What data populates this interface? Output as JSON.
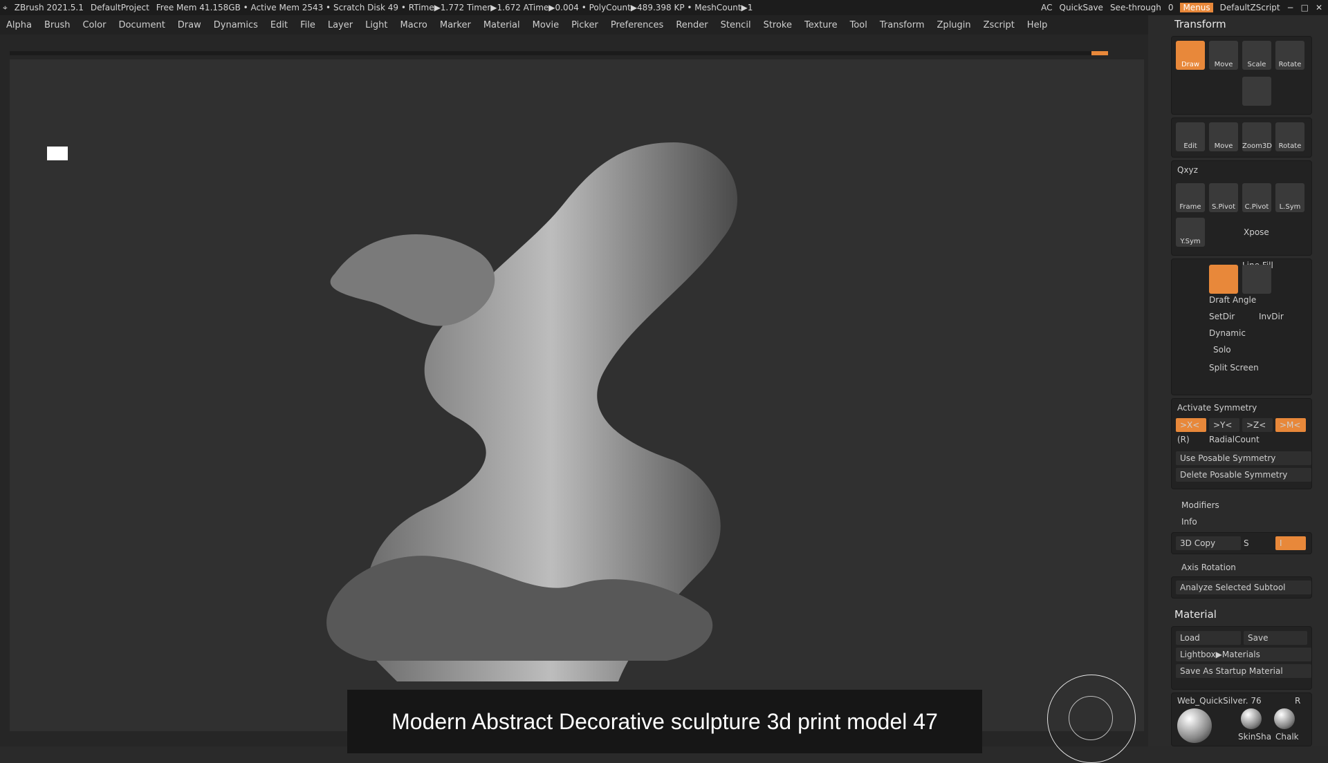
{
  "app": {
    "title": "ZBrush 2021.5.1",
    "project": "DefaultProject",
    "status_line": "Free Mem 41.158GB • Active Mem 2543 • Scratch Disk 49 • RTime▶1.772 Timer▶1.672 ATime▶0.004 • PolyCount▶489.398 KP • MeshCount▶1",
    "right_controls": {
      "ac": "AC",
      "quicksave": "QuickSave",
      "see_through_label": "See-through",
      "see_through_value": "0",
      "menus": "Menus",
      "default_zscript": "DefaultZScript"
    }
  },
  "menubar": {
    "items": [
      "Alpha",
      "Brush",
      "Color",
      "Document",
      "Draw",
      "Dynamics",
      "Edit",
      "File",
      "Layer",
      "Light",
      "Macro",
      "Marker",
      "Material",
      "Movie",
      "Picker",
      "Preferences",
      "Render",
      "Stencil",
      "Stroke",
      "Texture",
      "Tool",
      "Transform",
      "Zplugin",
      "Zscript",
      "Help"
    ]
  },
  "viewport": {
    "caption": "Modern Abstract Decorative sculpture 3d print model 47"
  },
  "transform_panel": {
    "title": "Transform",
    "top_buttons": [
      "Draw",
      "Move",
      "Scale",
      "Rotate"
    ],
    "nav_buttons": [
      "Edit",
      "Move",
      "Zoom3D",
      "Rotate"
    ],
    "xyz_labels": [
      "Qxyz",
      "Frame",
      "S.Pivot",
      "C.Pivot",
      "L.Sym",
      "Y.Sym",
      "Xpose"
    ],
    "xpose": "Xpose",
    "line_fill": "Line Fill",
    "draft_angle": "Draft Angle",
    "set_dir": "SetDir",
    "inv_dir": "InvDir",
    "dynamic": "Dynamic",
    "solo": "Solo",
    "split_screen": "Split Screen",
    "activate_symmetry": "Activate Symmetry",
    "sym_axes": [
      ">X<",
      ">Y<",
      ">Z<",
      ">M<"
    ],
    "radial_r": "(R)",
    "radial_count": "RadialCount",
    "use_posable": "Use Posable Symmetry",
    "delete_posable": "Delete Posable Symmetry",
    "modifiers": "Modifiers",
    "info": "Info",
    "copy3d": "3D Copy",
    "s_label": "S",
    "i_label": "I",
    "axis_rotation": "Axis Rotation",
    "analyze": "Analyze Selected Subtool"
  },
  "material_panel": {
    "title": "Material",
    "load": "Load",
    "save": "Save",
    "lightbox": "Lightbox▶Materials",
    "save_startup": "Save As Startup Material",
    "current": "Web_QuickSilver. 76",
    "r": "R",
    "thumbs": [
      "SkinSha",
      "Chalk"
    ]
  },
  "colors": {
    "accent": "#e8883a",
    "panel_bg": "#2b2b2b",
    "viewport_bg": "#303030"
  }
}
